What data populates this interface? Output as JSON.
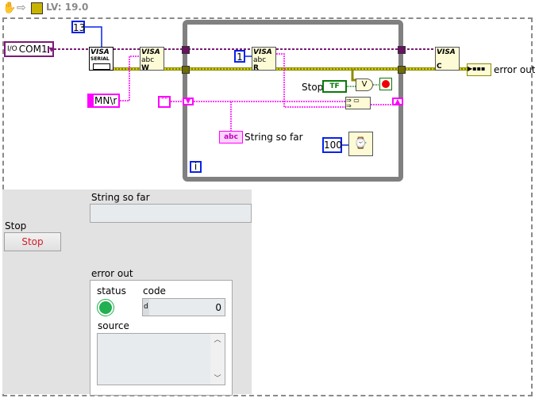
{
  "toolbar": {
    "version": "LV: 19.0",
    "icons": [
      "hand-icon",
      "arrow-icon",
      "labview-vi-icon"
    ]
  },
  "diagram": {
    "visa_resource": "COM1",
    "baud_const": "13",
    "write_string": "MN\\r",
    "empty_string": "\"\"",
    "read_count": "1",
    "stop_label": "Stop",
    "stop_terminal": "TF",
    "string_indicator_label": "String so far",
    "string_indicator_glyph": "abc",
    "wait_ms": "100",
    "iteration": "i",
    "error_out_label": "error out",
    "visa_text": "VISA",
    "serial_text": "SERIAL",
    "write_letter": "W",
    "read_letter": "R",
    "close_letter": "C",
    "or_symbol": "V",
    "abc": "abc"
  },
  "front_panel": {
    "stop_label": "Stop",
    "stop_button": "Stop",
    "string_label": "String so far",
    "string_value": "",
    "error_cluster": {
      "label": "error out",
      "status_label": "status",
      "status_ok": true,
      "code_label": "code",
      "code_radix": "d",
      "code_value": "0",
      "source_label": "source",
      "source_value": ""
    }
  },
  "colors": {
    "refnum": "#7b1c76",
    "error": "#c9c900",
    "string": "#ff00ff",
    "numeric": "#0a22e8",
    "boolean": "#0a7a0a",
    "status_ok": "#22b050"
  }
}
